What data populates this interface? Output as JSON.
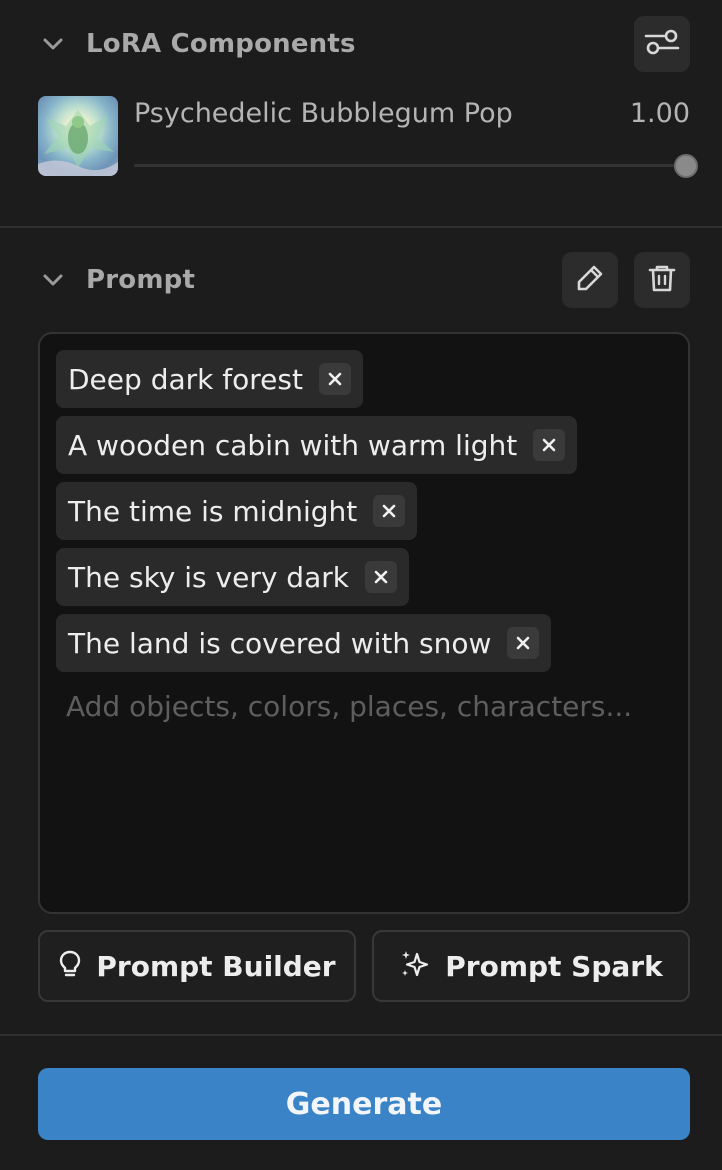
{
  "lora": {
    "title": "LoRA Components",
    "item": {
      "name": "Psychedelic Bubblegum Pop",
      "weight": "1.00",
      "slider_value": 1.0
    }
  },
  "prompt": {
    "title": "Prompt",
    "chips": [
      "Deep dark forest",
      "A wooden cabin with warm light",
      "The time is midnight",
      "The sky is very dark",
      "The land is covered with snow"
    ],
    "placeholder": "Add objects, colors, places, characters..."
  },
  "actions": {
    "builder_label": "Prompt Builder",
    "spark_label": "Prompt Spark"
  },
  "generate_label": "Generate",
  "colors": {
    "background": "#1c1c1c",
    "accent": "#3a83c7",
    "chip": "#2a2a2a"
  }
}
